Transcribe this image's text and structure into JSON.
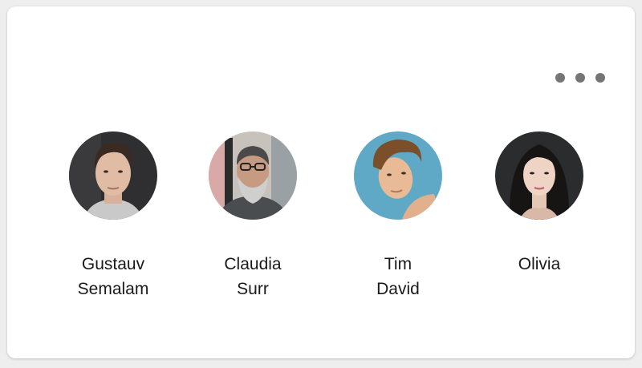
{
  "menu": {
    "icon": "more-horizontal-icon"
  },
  "people": [
    {
      "name": "Gustauv\nSemalam",
      "avatar": "avatar-gustauv-semalam"
    },
    {
      "name": "Claudia\nSurr",
      "avatar": "avatar-claudia-surr"
    },
    {
      "name": "Tim\nDavid",
      "avatar": "avatar-tim-david"
    },
    {
      "name": "Olivia",
      "avatar": "avatar-olivia"
    }
  ]
}
